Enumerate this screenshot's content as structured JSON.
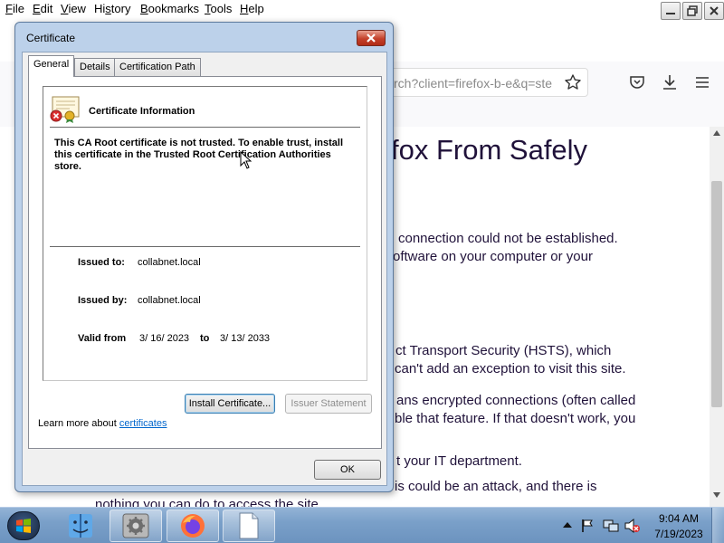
{
  "menubar": {
    "items": [
      {
        "pre": "",
        "ul": "F",
        "post": "ile"
      },
      {
        "pre": "",
        "ul": "E",
        "post": "dit"
      },
      {
        "pre": "",
        "ul": "V",
        "post": "iew"
      },
      {
        "pre": "Hi",
        "ul": "s",
        "post": "tory"
      },
      {
        "pre": "",
        "ul": "B",
        "post": "ookmarks"
      },
      {
        "pre": "",
        "ul": "T",
        "post": "ools"
      },
      {
        "pre": "",
        "ul": "H",
        "post": "elp"
      }
    ]
  },
  "browser": {
    "url_fragment": "rch?client=firefox-b-e&q=ste",
    "heading_fragment": "fox From Safely",
    "paragraphs": [
      "connection could not be established.",
      "oftware on your computer or your",
      "ct Transport Security (HSTS), which",
      "can't add an exception to visit this site.",
      "ans encrypted connections (often called",
      "ble that feature. If that doesn't work, you",
      "t your IT department.",
      "is could be an attack, and there is",
      "nothing you can do to access the site."
    ]
  },
  "dialog": {
    "title": "Certificate",
    "tabs": [
      "General",
      "Details",
      "Certification Path"
    ],
    "info_title": "Certificate Information",
    "warning": "This CA Root certificate is not trusted. To enable trust, install this certificate in the Trusted Root Certification Authorities store.",
    "issued_to_label": "Issued to:",
    "issued_to": "collabnet.local",
    "issued_by_label": "Issued by:",
    "issued_by": "collabnet.local",
    "valid_from_label": "Valid from",
    "valid_from": "3/ 16/ 2023",
    "to_label": "to",
    "valid_to": "3/ 13/ 2033",
    "install_button": "Install Certificate...",
    "issuer_button": "Issuer Statement",
    "learn_more_prefix": "Learn more about ",
    "learn_more_link": "certificates",
    "ok_button": "OK"
  },
  "taskbar": {
    "time": "9:04 AM",
    "date": "7/19/2023",
    "apps": [
      "finder-app",
      "settings-app",
      "firefox-app",
      "document-app"
    ]
  },
  "colors": {
    "accent_link": "#0066cc",
    "close_red": "#c4412a",
    "taskbar_blue": "#7aa0c9",
    "dialog_frame": "#bcd1ea"
  }
}
